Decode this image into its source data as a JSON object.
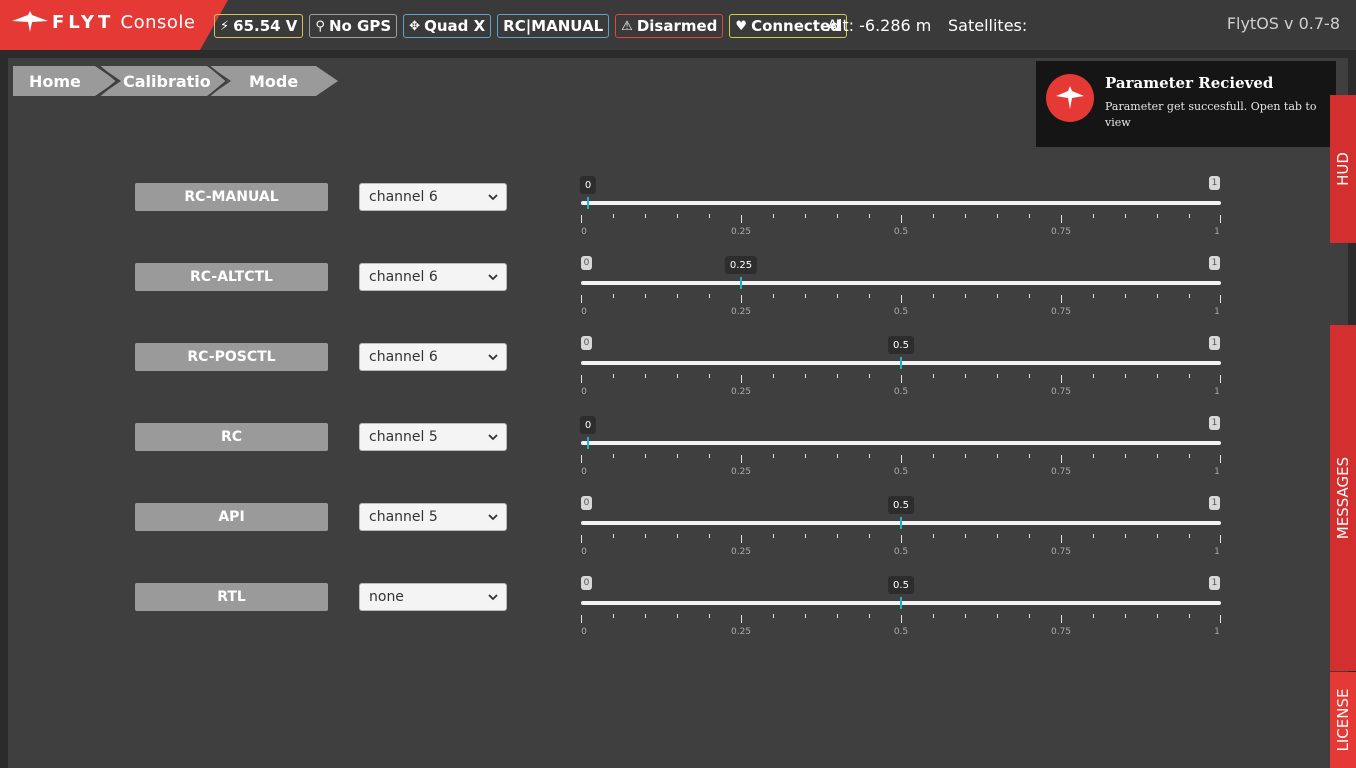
{
  "app": {
    "logo_brand": "FLYT",
    "logo_product": "Console",
    "version": "FlytOS v 0.7-8"
  },
  "status": {
    "voltage": "65.54 V",
    "gps": "No GPS",
    "frame": "Quad X",
    "mode": "RC|MANUAL",
    "arm_state": "Disarmed",
    "connection": "Connected",
    "altitude": "Alt: -6.286 m",
    "satellites": "Satellites:"
  },
  "breadcrumb": [
    "Home",
    "Calibratio",
    "Mode"
  ],
  "toast": {
    "title": "Parameter Recieved",
    "message": "Parameter get succesfull. Open tab to view"
  },
  "side_tabs": [
    "HUD",
    "MESSAGES",
    "LICENSE"
  ],
  "slider_scale": {
    "min": 0,
    "max": 1,
    "min_label": "0",
    "max_label": "1",
    "tick_labels": [
      "0",
      "0.25",
      "0.5",
      "0.75",
      "1"
    ]
  },
  "modes": [
    {
      "label": "RC-MANUAL",
      "channel": "channel 6",
      "value": 0,
      "value_label": "0"
    },
    {
      "label": "RC-ALTCTL",
      "channel": "channel 6",
      "value": 0.25,
      "value_label": "0.25"
    },
    {
      "label": "RC-POSCTL",
      "channel": "channel 6",
      "value": 0.5,
      "value_label": "0.5"
    },
    {
      "label": "RC",
      "channel": "channel 5",
      "value": 0,
      "value_label": "0"
    },
    {
      "label": "API",
      "channel": "channel 5",
      "value": 0.5,
      "value_label": "0.5"
    },
    {
      "label": "RTL",
      "channel": "none",
      "value": 0.5,
      "value_label": "0.5"
    }
  ],
  "colors": {
    "accent": "#e53935",
    "handle": "#21b4c0",
    "panel": "#3f3f3f",
    "topbar": "#3a3a3a"
  }
}
